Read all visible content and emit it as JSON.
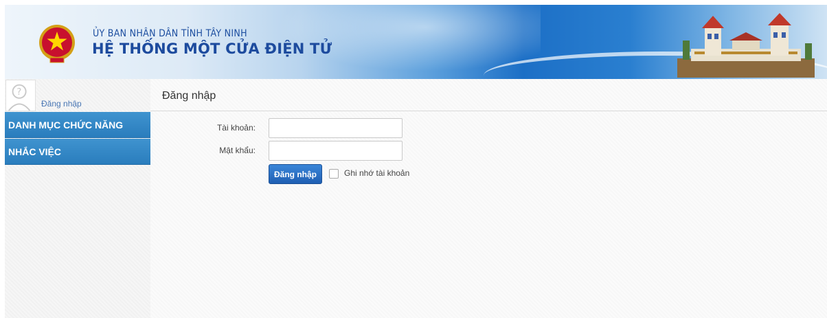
{
  "header": {
    "org_name": "ỦY BAN NHÂN DÂN TỈNH TÂY NINH",
    "system_name": "HỆ THỐNG MỘT CỬA ĐIỆN TỬ"
  },
  "sidebar": {
    "login_link": "Đăng nhập",
    "items": [
      {
        "label": "DANH MỤC CHỨC NĂNG"
      },
      {
        "label": "NHẮC VIỆC"
      }
    ]
  },
  "login_form": {
    "title": "Đăng nhập",
    "username_label": "Tài khoản:",
    "username_value": "",
    "password_label": "Mật khẩu:",
    "password_value": "",
    "submit_label": "Đăng nhập",
    "remember_label": "Ghi nhớ tài khoản",
    "remember_checked": false
  },
  "colors": {
    "nav_blue": "#2f86c7",
    "title_blue": "#1d4b9e",
    "button_blue": "#2a6fc4"
  }
}
